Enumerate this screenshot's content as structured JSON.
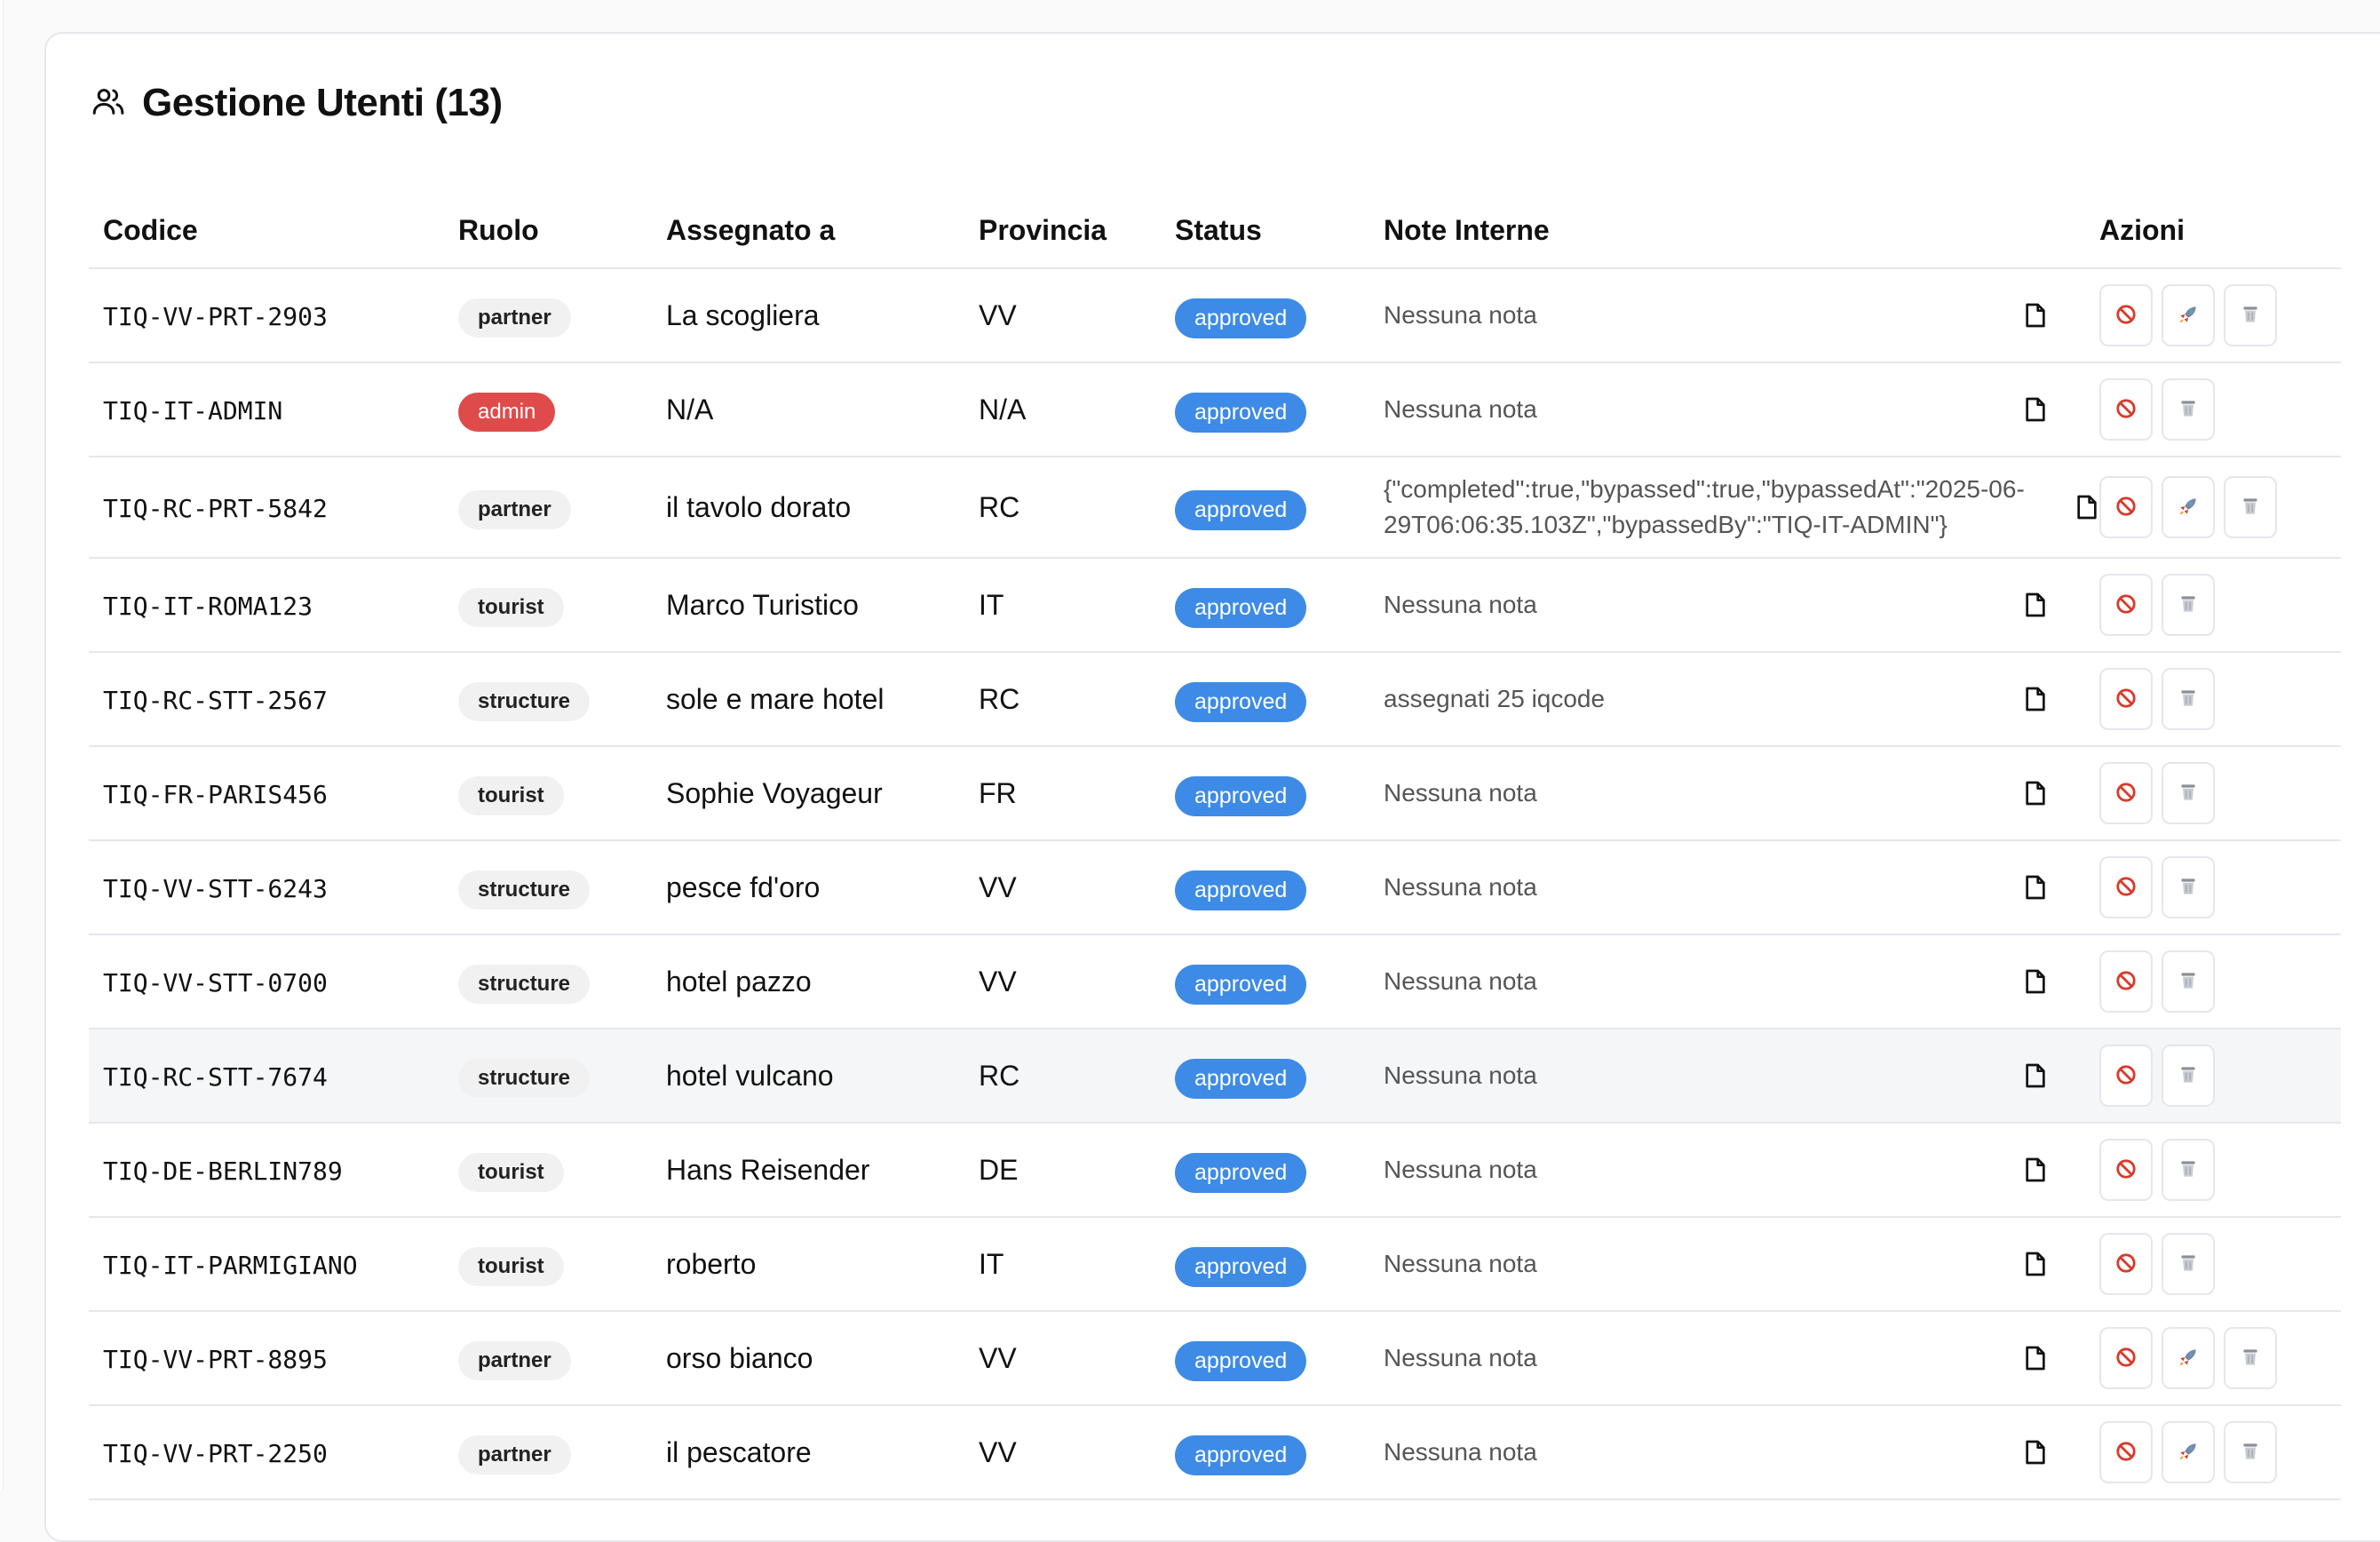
{
  "header": {
    "title": "Gestione Utenti (13)",
    "icon": "users-icon"
  },
  "columns": [
    "Codice",
    "Ruolo",
    "Assegnato a",
    "Provincia",
    "Status",
    "Note Interne",
    "Azioni"
  ],
  "rows": [
    {
      "code": "TIQ-VV-PRT-2903",
      "role": "partner",
      "assigned": "La scogliera",
      "province": "VV",
      "status": "approved",
      "note": "Nessuna nota"
    },
    {
      "code": "TIQ-IT-ADMIN",
      "role": "admin",
      "assigned": "N/A",
      "province": "N/A",
      "status": "approved",
      "note": "Nessuna nota"
    },
    {
      "code": "TIQ-RC-PRT-5842",
      "role": "partner",
      "assigned": "il tavolo dorato",
      "province": "RC",
      "status": "approved",
      "note": "{\"completed\":true,\"bypassed\":true,\"bypassedAt\":\"2025-06-29T06:06:35.103Z\",\"bypassedBy\":\"TIQ-IT-ADMIN\"}"
    },
    {
      "code": "TIQ-IT-ROMA123",
      "role": "tourist",
      "assigned": "Marco Turistico",
      "province": "IT",
      "status": "approved",
      "note": "Nessuna nota"
    },
    {
      "code": "TIQ-RC-STT-2567",
      "role": "structure",
      "assigned": "sole e mare hotel",
      "province": "RC",
      "status": "approved",
      "note": "assegnati 25 iqcode"
    },
    {
      "code": "TIQ-FR-PARIS456",
      "role": "tourist",
      "assigned": "Sophie Voyageur",
      "province": "FR",
      "status": "approved",
      "note": "Nessuna nota"
    },
    {
      "code": "TIQ-VV-STT-6243",
      "role": "structure",
      "assigned": "pesce fd'oro",
      "province": "VV",
      "status": "approved",
      "note": "Nessuna nota"
    },
    {
      "code": "TIQ-VV-STT-0700",
      "role": "structure",
      "assigned": "hotel pazzo",
      "province": "VV",
      "status": "approved",
      "note": "Nessuna nota"
    },
    {
      "code": "TIQ-RC-STT-7674",
      "role": "structure",
      "assigned": "hotel vulcano",
      "province": "RC",
      "status": "approved",
      "note": "Nessuna nota"
    },
    {
      "code": "TIQ-DE-BERLIN789",
      "role": "tourist",
      "assigned": "Hans Reisender",
      "province": "DE",
      "status": "approved",
      "note": "Nessuna nota"
    },
    {
      "code": "TIQ-IT-PARMIGIANO",
      "role": "tourist",
      "assigned": "roberto",
      "province": "IT",
      "status": "approved",
      "note": "Nessuna nota"
    },
    {
      "code": "TIQ-VV-PRT-8895",
      "role": "partner",
      "assigned": "orso bianco",
      "province": "VV",
      "status": "approved",
      "note": "Nessuna nota"
    },
    {
      "code": "TIQ-VV-PRT-2250",
      "role": "partner",
      "assigned": "il pescatore",
      "province": "VV",
      "status": "approved",
      "note": "Nessuna nota"
    }
  ],
  "actions": {
    "block": "block-icon",
    "rocket": "rocket-icon",
    "delete": "trash-icon",
    "note": "edit-note-icon"
  },
  "colors": {
    "status_approved": "#3d8be6",
    "role_admin": "#df4b4b",
    "block_red": "#d93a2b"
  }
}
